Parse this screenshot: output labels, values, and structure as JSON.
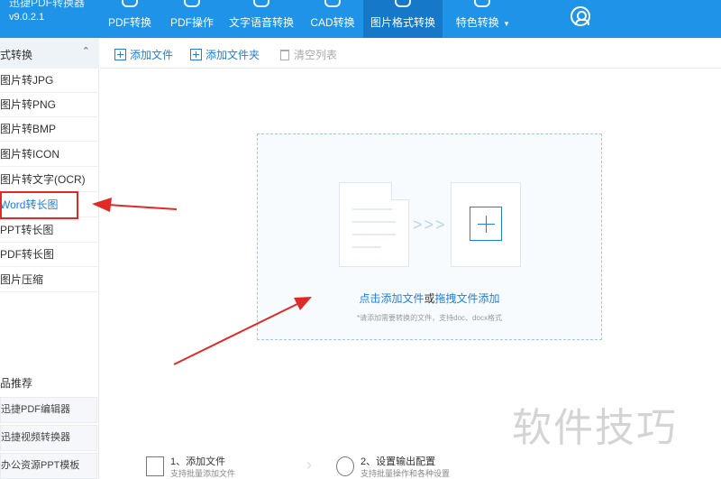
{
  "app": {
    "name": "迅捷PDF转换器",
    "version": "v9.0.2.1"
  },
  "nav": [
    {
      "label": "PDF转换"
    },
    {
      "label": "PDF操作"
    },
    {
      "label": "文字语音转换"
    },
    {
      "label": "CAD转换"
    },
    {
      "label": "图片格式转换",
      "active": true
    },
    {
      "label": "特色转换",
      "caret": "▾"
    }
  ],
  "sidebar": {
    "section": "式转换",
    "items": [
      {
        "label": "图片转JPG"
      },
      {
        "label": "图片转PNG"
      },
      {
        "label": "图片转BMP"
      },
      {
        "label": "图片转ICON"
      },
      {
        "label": "图片转文字(OCR)"
      },
      {
        "label": "Word转长图",
        "active": true
      },
      {
        "label": "PPT转长图"
      },
      {
        "label": "PDF转长图"
      },
      {
        "label": "图片压缩"
      }
    ],
    "recommend_title": "品推荐",
    "recommend": [
      {
        "label": "迅捷PDF编辑器"
      },
      {
        "label": "迅捷视频转换器"
      },
      {
        "label": "办公资源PPT模板"
      }
    ]
  },
  "toolbar": {
    "add_file": "添加文件",
    "add_folder": "添加文件夹",
    "clear_list": "清空列表"
  },
  "dropzone": {
    "click_add": "点击添加文件",
    "or": "或",
    "drag_add": "拖拽文件添加",
    "hint": "*请添加需要转换的文件，支持doc、docx格式"
  },
  "steps": [
    {
      "title": "1、添加文件",
      "sub": "支持批量添加文件"
    },
    {
      "title": "2、设置输出配置",
      "sub": "支持批量操作和各种设置"
    }
  ],
  "watermark": "软件技巧",
  "colors": {
    "topbar": "#1f93e8",
    "accent": "#1f7fe0",
    "highlight": "#e02a25"
  }
}
